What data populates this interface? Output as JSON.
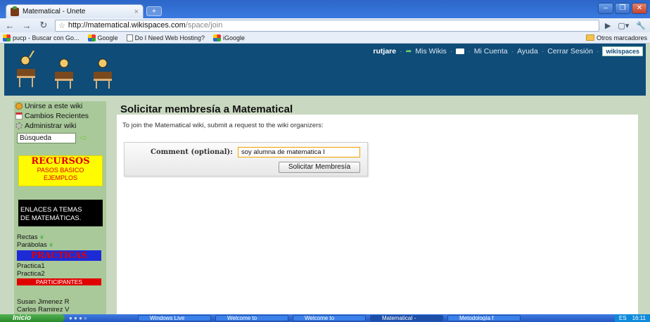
{
  "browser": {
    "tab_title": "Matematical - Únete",
    "tab_close": "×",
    "new_tab": "+",
    "url_host": "http://matematical.wikispaces.com",
    "url_path": "/space/join",
    "bookmarks": [
      "pucp - Buscar con Go...",
      "Google",
      "Do I Need Web Hosting?",
      "iGoogle"
    ],
    "other_bookmarks": "Otros marcadores"
  },
  "site": {
    "topnav": {
      "user": "rutjare",
      "mis_wikis": "Mis Wikis",
      "mi_cuenta": "Mi Cuenta",
      "ayuda": "Ayuda",
      "cerrar_sesion": "Cerrar Sesión",
      "badge": "wikispaces"
    }
  },
  "sidebar": {
    "unirse": "Unirse a este wiki",
    "cambios": "Cambios Recientes",
    "administrar": "Administrar wiki",
    "search_value": "Búsqueda",
    "recursos_title": "RECURSOS",
    "recursos_sub1": "PASOS BASICO",
    "recursos_sub2": "EJEMPLOS",
    "enlaces1": "ENLACES A TEMAS",
    "enlaces2": "DE MATEMÁTICAS.",
    "link1": "Rectas",
    "link2": "Parábolas",
    "practicas": "PRACTICAS",
    "practica1": "Practica1",
    "practica2": "Practica2",
    "participantes": "PARTICIPANTES",
    "person1": "Susan Jimenez R",
    "person2": "Carlos Ramirez V"
  },
  "main": {
    "title": "Solicitar membresía a Matematical",
    "intro": "To join the Matematical wiki, submit a request to the wiki organizers:",
    "comment_label": "Comment (optional):",
    "comment_value": "soy alumna de matematica I",
    "submit_label": "Solicitar Membresía"
  },
  "taskbar": {
    "start": "Inicio",
    "items": [
      "Windows Live",
      "Welcome to",
      "Welcome to",
      "MatematicaI -",
      "Metodología f"
    ],
    "lang": "ES",
    "clock": "16:11"
  }
}
